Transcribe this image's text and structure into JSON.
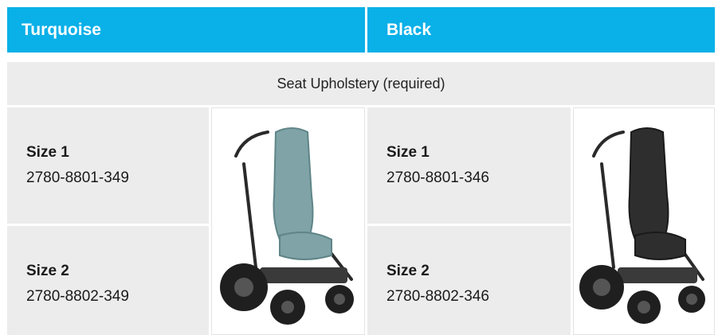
{
  "columns": [
    {
      "header": "Turquoise",
      "color": "#7fa3a6",
      "rows": [
        {
          "size": "Size 1",
          "part": "2780-8801-349"
        },
        {
          "size": "Size 2",
          "part": "2780-8802-349"
        }
      ]
    },
    {
      "header": "Black",
      "color": "#2e2e2e",
      "rows": [
        {
          "size": "Size 1",
          "part": "2780-8801-346"
        },
        {
          "size": "Size 2",
          "part": "2780-8802-346"
        }
      ]
    }
  ],
  "section_title": "Seat Upholstery (required)",
  "header_color": "#0ab0e8"
}
